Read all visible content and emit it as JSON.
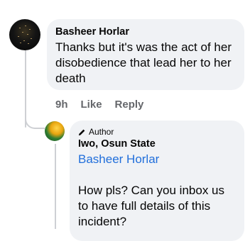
{
  "comment": {
    "author": "Basheer Horlar",
    "text": "Thanks but it's was the act of her disobedience that lead her to her death",
    "time": "9h",
    "like_label": "Like",
    "reply_label": "Reply"
  },
  "reply": {
    "badge_label": "Author",
    "author": "Iwo, Osun State",
    "mention": "Basheer Horlar",
    "text": "How pls? Can you inbox us to have full details of this incident?"
  },
  "icons": {
    "badge": "pencil-icon"
  },
  "colors": {
    "bubble": "#f0f2f5",
    "mention": "#216fdb",
    "meta": "#65676b",
    "thread_line": "#ced0d4"
  }
}
